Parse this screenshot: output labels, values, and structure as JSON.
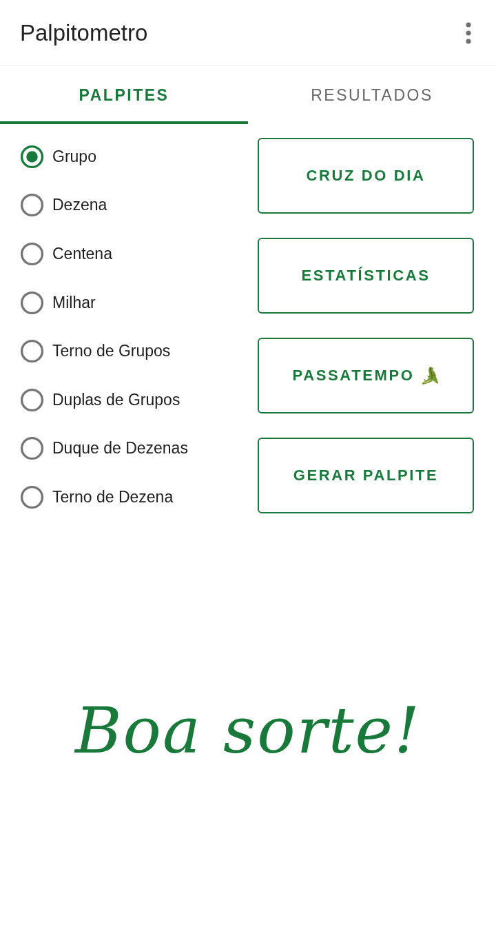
{
  "app_bar": {
    "title": "Palpitometro"
  },
  "tabs": [
    {
      "label": "PALPITES",
      "selected": true
    },
    {
      "label": "RESULTADOS",
      "selected": false
    }
  ],
  "options": [
    {
      "label": "Grupo",
      "selected": true
    },
    {
      "label": "Dezena",
      "selected": false
    },
    {
      "label": "Centena",
      "selected": false
    },
    {
      "label": "Milhar",
      "selected": false
    },
    {
      "label": "Terno de Grupos",
      "selected": false
    },
    {
      "label": "Duplas de Grupos",
      "selected": false
    },
    {
      "label": "Duque de Dezenas",
      "selected": false
    },
    {
      "label": "Terno de Dezena",
      "selected": false
    }
  ],
  "buttons": [
    {
      "label": "CRUZ DO DIA",
      "kind": "text"
    },
    {
      "label": "ESTATÍSTICAS",
      "kind": "text"
    },
    {
      "label": "PASSATEMPO",
      "kind": "emoji"
    },
    {
      "label": "GERAR PALPITE",
      "kind": "text"
    }
  ],
  "message": "Boa sorte!"
}
